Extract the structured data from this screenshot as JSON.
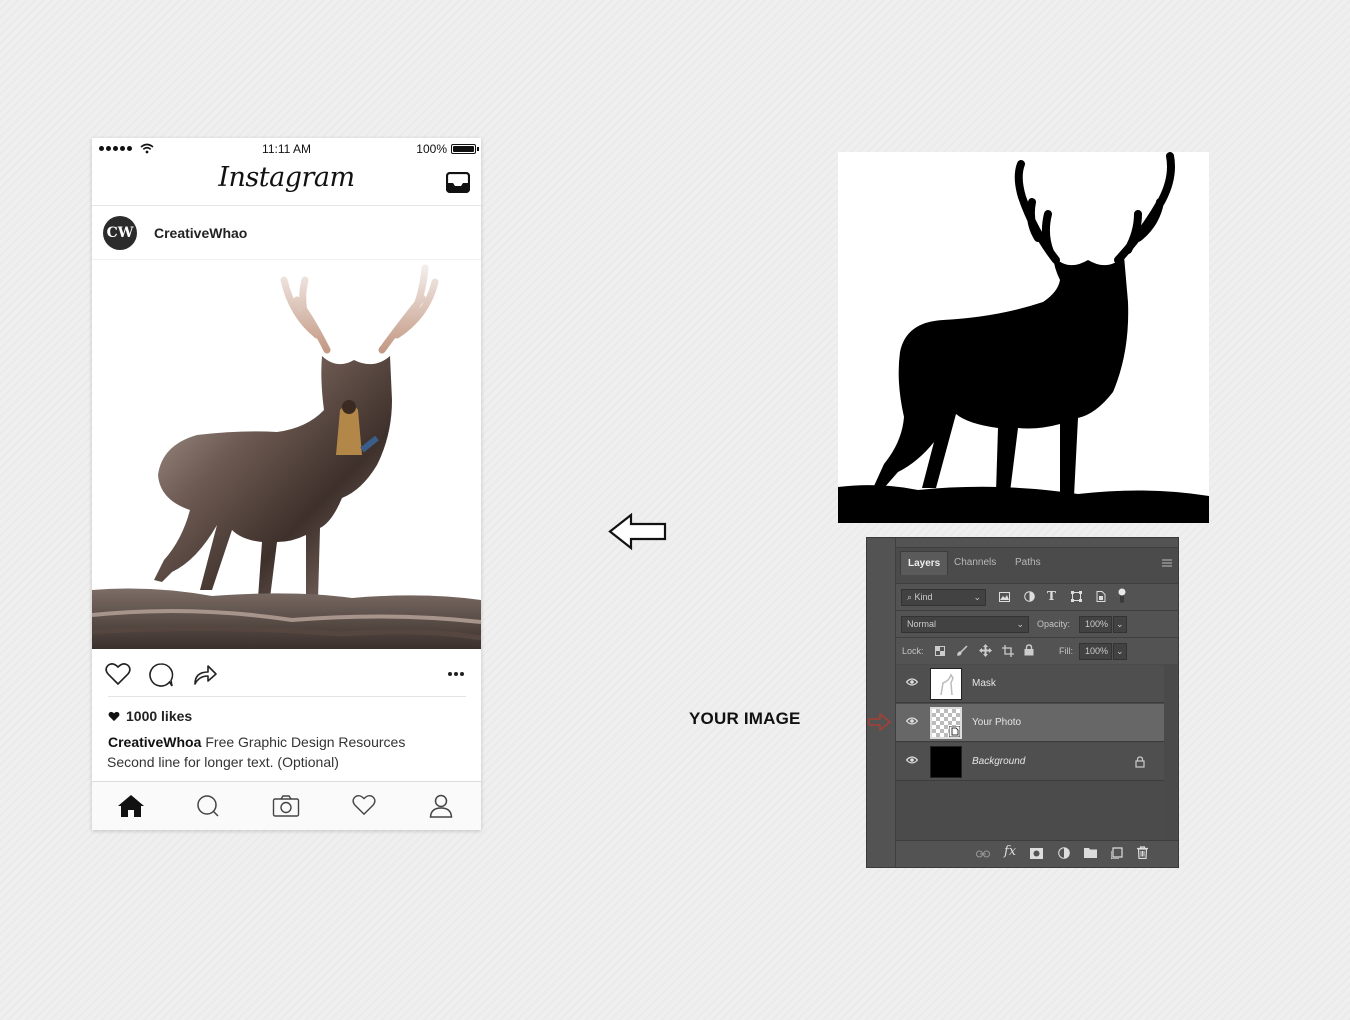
{
  "phone": {
    "status": {
      "time": "11:11 AM",
      "battery": "100%"
    },
    "app_name": "Instagram",
    "post": {
      "avatar_initials": "CW",
      "username": "CreativeWhao",
      "likes": "1000 likes",
      "caption_user": "CreativeWhoa",
      "caption_text": "Free Graphic Design Resources",
      "caption_second_line": "Second line for longer text. (Optional)"
    },
    "icons": {
      "actions": [
        "heart-icon",
        "comment-icon",
        "share-icon",
        "more-icon"
      ],
      "tabs": [
        "home-icon",
        "search-icon",
        "camera-icon",
        "activity-heart-icon",
        "profile-icon"
      ]
    }
  },
  "label": {
    "your_image": "YOUR IMAGE"
  },
  "layers_panel": {
    "tabs": [
      "Layers",
      "Channels",
      "Paths"
    ],
    "filter_kind": "Kind",
    "blend_mode": "Normal",
    "opacity_label": "Opacity:",
    "opacity_value": "100%",
    "lock_label": "Lock:",
    "fill_label": "Fill:",
    "fill_value": "100%",
    "layers": [
      {
        "name": "Mask",
        "selected": false
      },
      {
        "name": "Your Photo",
        "selected": true
      },
      {
        "name": "Background",
        "selected": false,
        "locked": true
      }
    ]
  },
  "colors": {
    "page_bg": "#efefef",
    "panel_bg": "#4b4b4b",
    "selected_layer": "#676767",
    "pointer_red": "#c0392b"
  }
}
